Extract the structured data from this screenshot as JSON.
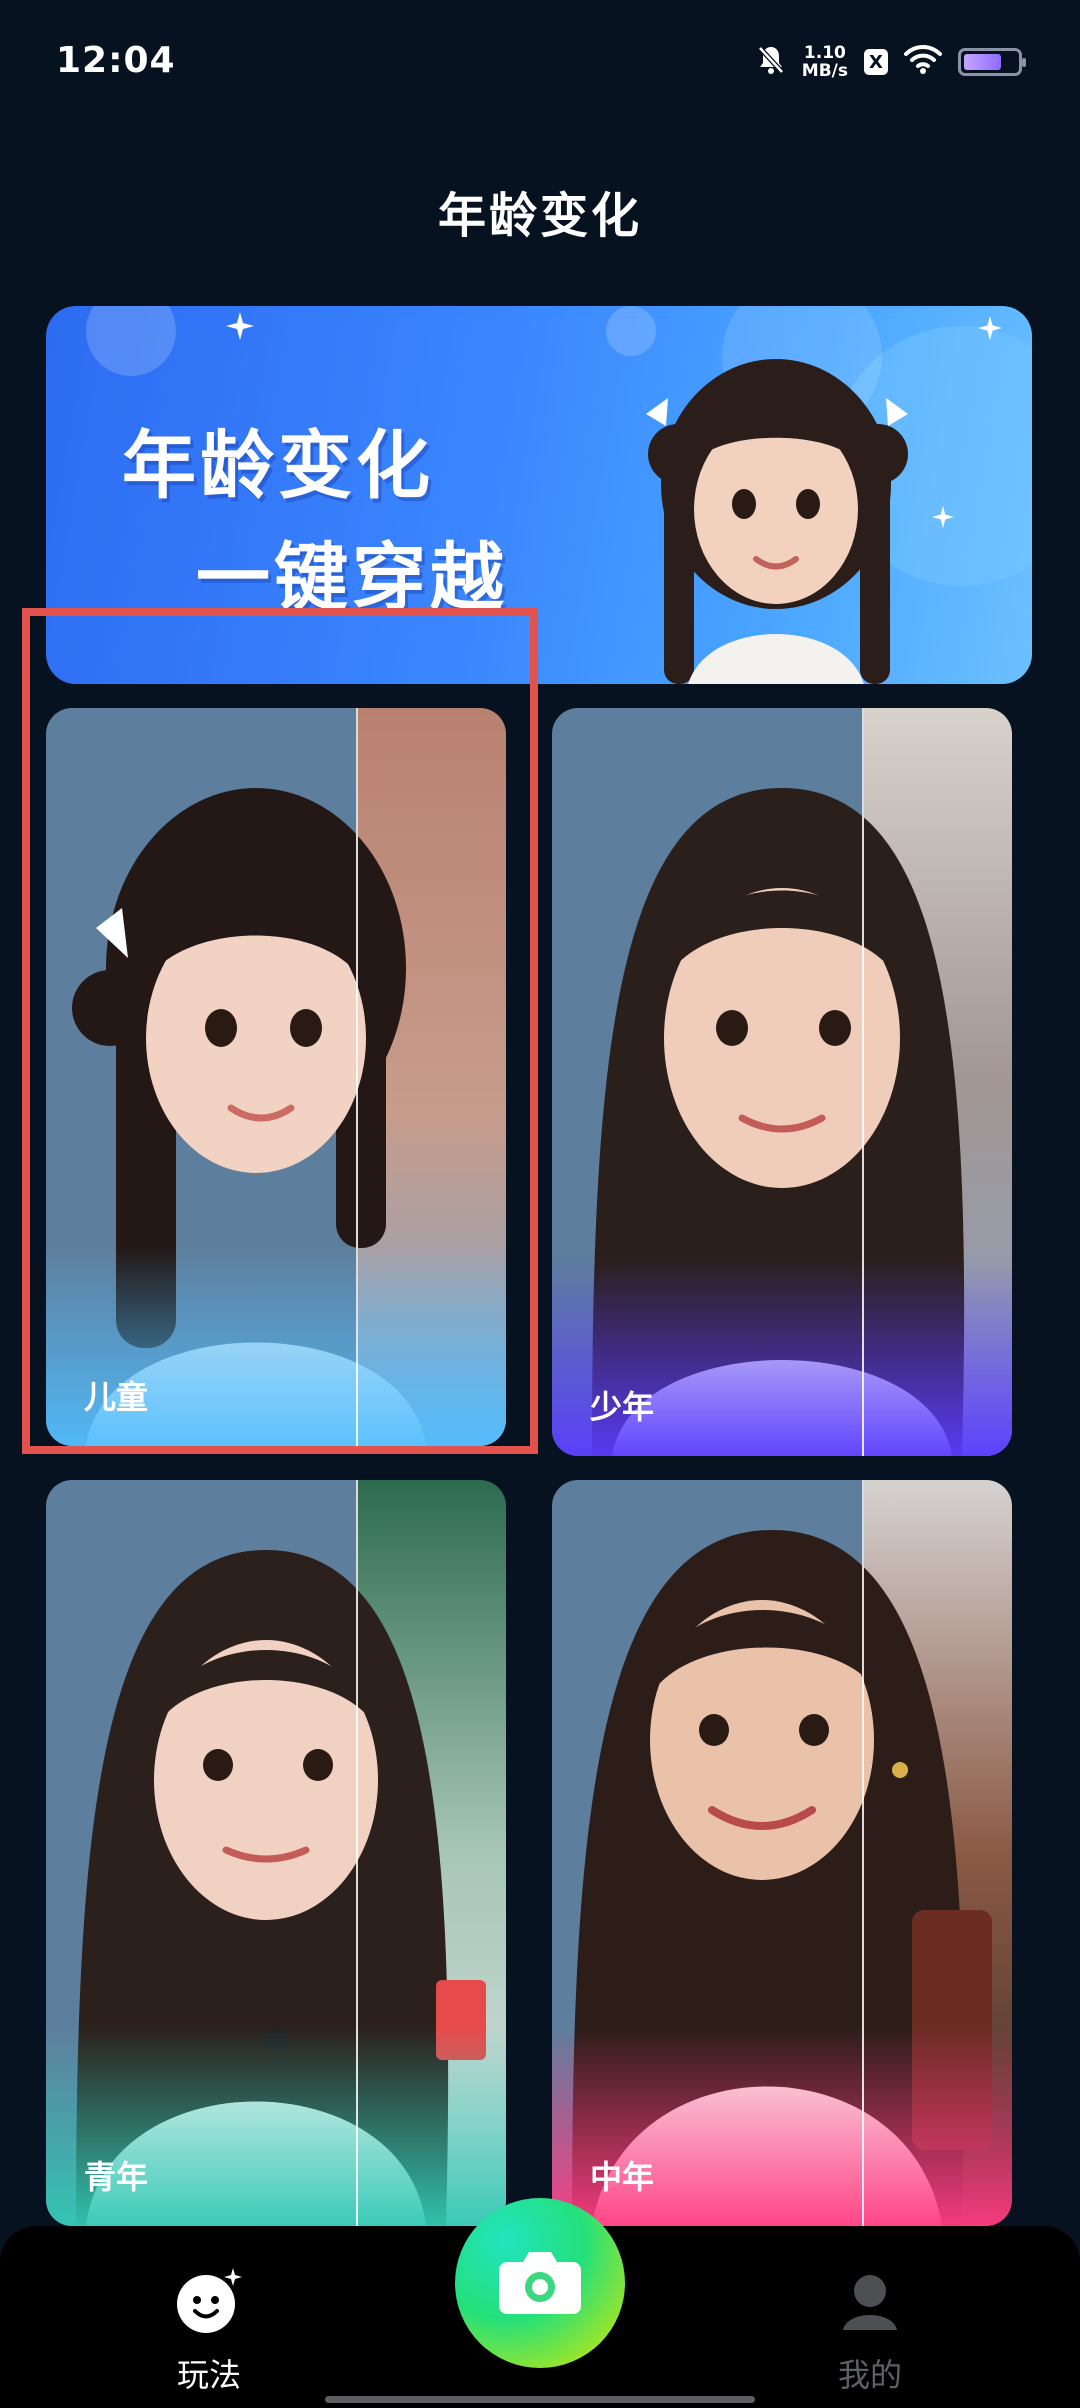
{
  "status_bar": {
    "time": "12:04",
    "net_speed_value": "1.10",
    "net_speed_unit": "MB/s",
    "x_badge": "X",
    "battery_level_pct": 80,
    "icons": [
      "bell-off-icon",
      "x-app-icon",
      "wifi-icon",
      "battery-icon"
    ]
  },
  "header": {
    "title": "年龄变化"
  },
  "banner": {
    "title": "年龄变化",
    "subtitle": "一键穿越"
  },
  "cards": [
    {
      "label": "儿童"
    },
    {
      "label": "少年"
    },
    {
      "label": "青年"
    },
    {
      "label": "中年"
    }
  ],
  "bottom_nav": {
    "play": {
      "label": "玩法",
      "icon": "smile-icon"
    },
    "camera": {
      "icon": "camera-icon"
    },
    "mine": {
      "label": "我的",
      "icon": "user-icon"
    }
  },
  "colors": {
    "background": "#06121f",
    "highlight": "#e2534d",
    "camera_start": "#22e3c0",
    "camera_end": "#e6e51c"
  }
}
